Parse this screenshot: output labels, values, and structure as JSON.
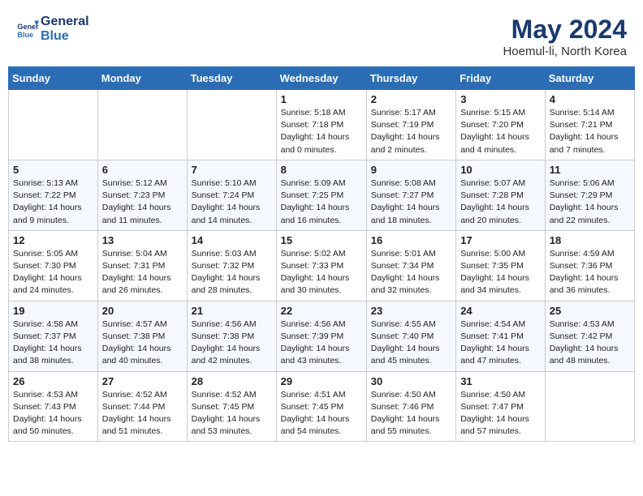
{
  "header": {
    "logo_line1": "General",
    "logo_line2": "Blue",
    "main_title": "May 2024",
    "subtitle": "Hoemul-li, North Korea"
  },
  "weekdays": [
    "Sunday",
    "Monday",
    "Tuesday",
    "Wednesday",
    "Thursday",
    "Friday",
    "Saturday"
  ],
  "weeks": [
    [
      {
        "day": "",
        "info": ""
      },
      {
        "day": "",
        "info": ""
      },
      {
        "day": "",
        "info": ""
      },
      {
        "day": "1",
        "info": "Sunrise: 5:18 AM\nSunset: 7:18 PM\nDaylight: 14 hours\nand 0 minutes."
      },
      {
        "day": "2",
        "info": "Sunrise: 5:17 AM\nSunset: 7:19 PM\nDaylight: 14 hours\nand 2 minutes."
      },
      {
        "day": "3",
        "info": "Sunrise: 5:15 AM\nSunset: 7:20 PM\nDaylight: 14 hours\nand 4 minutes."
      },
      {
        "day": "4",
        "info": "Sunrise: 5:14 AM\nSunset: 7:21 PM\nDaylight: 14 hours\nand 7 minutes."
      }
    ],
    [
      {
        "day": "5",
        "info": "Sunrise: 5:13 AM\nSunset: 7:22 PM\nDaylight: 14 hours\nand 9 minutes."
      },
      {
        "day": "6",
        "info": "Sunrise: 5:12 AM\nSunset: 7:23 PM\nDaylight: 14 hours\nand 11 minutes."
      },
      {
        "day": "7",
        "info": "Sunrise: 5:10 AM\nSunset: 7:24 PM\nDaylight: 14 hours\nand 14 minutes."
      },
      {
        "day": "8",
        "info": "Sunrise: 5:09 AM\nSunset: 7:25 PM\nDaylight: 14 hours\nand 16 minutes."
      },
      {
        "day": "9",
        "info": "Sunrise: 5:08 AM\nSunset: 7:27 PM\nDaylight: 14 hours\nand 18 minutes."
      },
      {
        "day": "10",
        "info": "Sunrise: 5:07 AM\nSunset: 7:28 PM\nDaylight: 14 hours\nand 20 minutes."
      },
      {
        "day": "11",
        "info": "Sunrise: 5:06 AM\nSunset: 7:29 PM\nDaylight: 14 hours\nand 22 minutes."
      }
    ],
    [
      {
        "day": "12",
        "info": "Sunrise: 5:05 AM\nSunset: 7:30 PM\nDaylight: 14 hours\nand 24 minutes."
      },
      {
        "day": "13",
        "info": "Sunrise: 5:04 AM\nSunset: 7:31 PM\nDaylight: 14 hours\nand 26 minutes."
      },
      {
        "day": "14",
        "info": "Sunrise: 5:03 AM\nSunset: 7:32 PM\nDaylight: 14 hours\nand 28 minutes."
      },
      {
        "day": "15",
        "info": "Sunrise: 5:02 AM\nSunset: 7:33 PM\nDaylight: 14 hours\nand 30 minutes."
      },
      {
        "day": "16",
        "info": "Sunrise: 5:01 AM\nSunset: 7:34 PM\nDaylight: 14 hours\nand 32 minutes."
      },
      {
        "day": "17",
        "info": "Sunrise: 5:00 AM\nSunset: 7:35 PM\nDaylight: 14 hours\nand 34 minutes."
      },
      {
        "day": "18",
        "info": "Sunrise: 4:59 AM\nSunset: 7:36 PM\nDaylight: 14 hours\nand 36 minutes."
      }
    ],
    [
      {
        "day": "19",
        "info": "Sunrise: 4:58 AM\nSunset: 7:37 PM\nDaylight: 14 hours\nand 38 minutes."
      },
      {
        "day": "20",
        "info": "Sunrise: 4:57 AM\nSunset: 7:38 PM\nDaylight: 14 hours\nand 40 minutes."
      },
      {
        "day": "21",
        "info": "Sunrise: 4:56 AM\nSunset: 7:38 PM\nDaylight: 14 hours\nand 42 minutes."
      },
      {
        "day": "22",
        "info": "Sunrise: 4:56 AM\nSunset: 7:39 PM\nDaylight: 14 hours\nand 43 minutes."
      },
      {
        "day": "23",
        "info": "Sunrise: 4:55 AM\nSunset: 7:40 PM\nDaylight: 14 hours\nand 45 minutes."
      },
      {
        "day": "24",
        "info": "Sunrise: 4:54 AM\nSunset: 7:41 PM\nDaylight: 14 hours\nand 47 minutes."
      },
      {
        "day": "25",
        "info": "Sunrise: 4:53 AM\nSunset: 7:42 PM\nDaylight: 14 hours\nand 48 minutes."
      }
    ],
    [
      {
        "day": "26",
        "info": "Sunrise: 4:53 AM\nSunset: 7:43 PM\nDaylight: 14 hours\nand 50 minutes."
      },
      {
        "day": "27",
        "info": "Sunrise: 4:52 AM\nSunset: 7:44 PM\nDaylight: 14 hours\nand 51 minutes."
      },
      {
        "day": "28",
        "info": "Sunrise: 4:52 AM\nSunset: 7:45 PM\nDaylight: 14 hours\nand 53 minutes."
      },
      {
        "day": "29",
        "info": "Sunrise: 4:51 AM\nSunset: 7:45 PM\nDaylight: 14 hours\nand 54 minutes."
      },
      {
        "day": "30",
        "info": "Sunrise: 4:50 AM\nSunset: 7:46 PM\nDaylight: 14 hours\nand 55 minutes."
      },
      {
        "day": "31",
        "info": "Sunrise: 4:50 AM\nSunset: 7:47 PM\nDaylight: 14 hours\nand 57 minutes."
      },
      {
        "day": "",
        "info": ""
      }
    ]
  ]
}
